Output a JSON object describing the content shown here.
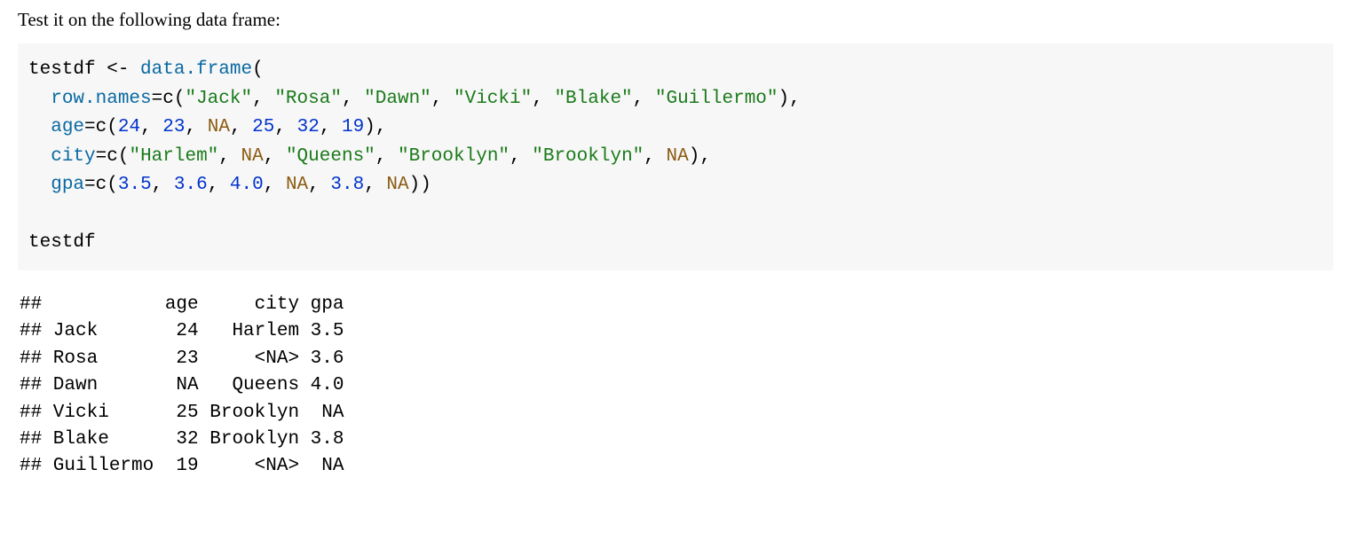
{
  "intro": "Test it on the following data frame:",
  "code": {
    "line1": {
      "var": "testdf",
      "assign": " <- ",
      "func": "data.frame",
      "open": "("
    },
    "line2": {
      "indent": "  ",
      "arg": "row.names",
      "eq": "=",
      "cfunc": "c",
      "open": "(",
      "s1": "\"Jack\"",
      "c1": ", ",
      "s2": "\"Rosa\"",
      "c2": ", ",
      "s3": "\"Dawn\"",
      "c3": ", ",
      "s4": "\"Vicki\"",
      "c4": ", ",
      "s5": "\"Blake\"",
      "c5": ", ",
      "s6": "\"Guillermo\"",
      "close": "),"
    },
    "line3": {
      "indent": "  ",
      "arg": "age",
      "eq": "=",
      "cfunc": "c",
      "open": "(",
      "n1": "24",
      "c1": ", ",
      "n2": "23",
      "c2": ", ",
      "na1": "NA",
      "c3": ", ",
      "n3": "25",
      "c4": ", ",
      "n4": "32",
      "c5": ", ",
      "n5": "19",
      "close": "),"
    },
    "line4": {
      "indent": "  ",
      "arg": "city",
      "eq": "=",
      "cfunc": "c",
      "open": "(",
      "s1": "\"Harlem\"",
      "c1": ", ",
      "na1": "NA",
      "c2": ", ",
      "s2": "\"Queens\"",
      "c3": ", ",
      "s3": "\"Brooklyn\"",
      "c4": ", ",
      "s4": "\"Brooklyn\"",
      "c5": ", ",
      "na2": "NA",
      "close": "),"
    },
    "line5": {
      "indent": "  ",
      "arg": "gpa",
      "eq": "=",
      "cfunc": "c",
      "open": "(",
      "n1": "3.5",
      "c1": ", ",
      "n2": "3.6",
      "c2": ", ",
      "n3": "4.0",
      "c3": ", ",
      "na1": "NA",
      "c4": ", ",
      "n4": "3.8",
      "c5": ", ",
      "na2": "NA",
      "close": "))"
    },
    "blank": "",
    "line6": "testdf"
  },
  "output": {
    "l1": "##           age     city gpa",
    "l2": "## Jack       24   Harlem 3.5",
    "l3": "## Rosa       23     <NA> 3.6",
    "l4": "## Dawn       NA   Queens 4.0",
    "l5": "## Vicki      25 Brooklyn  NA",
    "l6": "## Blake      32 Brooklyn 3.8",
    "l7": "## Guillermo  19     <NA>  NA"
  },
  "chart_data": {
    "type": "table",
    "columns": [
      "",
      "age",
      "city",
      "gpa"
    ],
    "rows": [
      [
        "Jack",
        24,
        "Harlem",
        3.5
      ],
      [
        "Rosa",
        23,
        null,
        3.6
      ],
      [
        "Dawn",
        null,
        "Queens",
        4.0
      ],
      [
        "Vicki",
        25,
        "Brooklyn",
        null
      ],
      [
        "Blake",
        32,
        "Brooklyn",
        3.8
      ],
      [
        "Guillermo",
        19,
        null,
        null
      ]
    ],
    "title": "testdf"
  }
}
